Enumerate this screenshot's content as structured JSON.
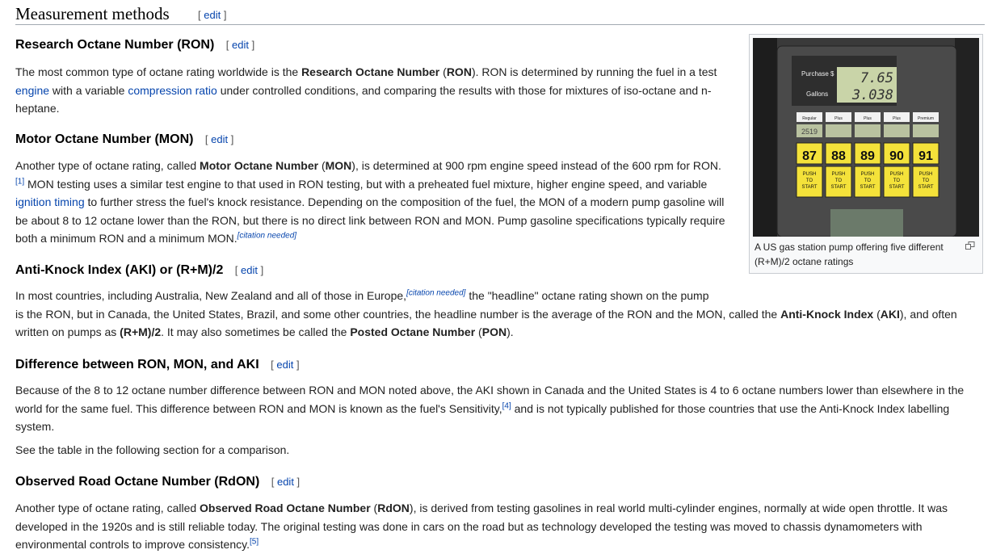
{
  "section": {
    "title": "Measurement methods",
    "edit": "edit"
  },
  "ron": {
    "heading": "Research Octane Number (RON)",
    "edit": "edit",
    "p1": "The most common type of octane rating worldwide is the ",
    "b1": "Research Octane Number",
    "p2": " (",
    "b2": "RON",
    "p3": "). RON is determined by running the fuel in a test",
    "link_engine": "engine",
    "p4": " with a variable ",
    "link_compression": "compression ratio",
    "p5": " under controlled conditions, and comparing the results with those for mixtures of iso-octane and n-heptane."
  },
  "mon": {
    "heading": "Motor Octane Number (MON)",
    "edit": "edit",
    "p1": "Another type of octane rating, called ",
    "b1": "Motor Octane Number",
    "p2": " (",
    "b2": "MON",
    "p3": "), is determined at 900 rpm engine speed instead of the 600 rpm for RON.",
    "ref1": "[1]",
    "p4": " MON testing uses a similar test engine to that used in RON testing, but with a preheated fuel mixture, higher engine speed, and variable ",
    "link_ignition": "ignition timing",
    "p5": " to further stress the fuel's knock resistance. Depending on the composition of the fuel, the MON of a modern pump gasoline will be about 8 to 12 octane lower than the RON, but there is no direct link between RON and MON. Pump gasoline specifications typically require both a minimum RON and a minimum MON.",
    "cn": "[citation needed]"
  },
  "aki": {
    "heading": "Anti-Knock Index (AKI) or (R+M)/2",
    "edit": "edit",
    "p1": "In most countries, including Australia, New Zealand and all of those in Europe,",
    "cn": "[citation needed]",
    "p2": " the \"headline\" octane rating shown on the pump",
    "p3": "is the RON, but in Canada, the United States, Brazil, and some other countries, the headline number is the average of the RON and the MON, called the ",
    "b1": "Anti-Knock Index",
    "p4": " (",
    "b2": "AKI",
    "p5": "), and often written on pumps as ",
    "b3": "(R+M)/2",
    "p6": ". It may also sometimes be called the ",
    "b4": "Posted Octane Number",
    "p7": " (",
    "b5": "PON",
    "p8": ")."
  },
  "diff": {
    "heading": "Difference between RON, MON, and AKI",
    "edit": "edit",
    "p1": "Because of the 8 to 12 octane number difference between RON and MON noted above, the AKI shown in Canada and the United States is 4 to 6 octane numbers lower than elsewhere in the world for the same fuel. This difference between RON and MON is known as the fuel's Sensitivity,",
    "ref4": "[4]",
    "p2": " and is not typically published for those countries that use the Anti-Knock Index labelling system.",
    "see": "See the table in the following section for a comparison."
  },
  "rdon": {
    "heading": "Observed Road Octane Number (RdON)",
    "edit": "edit",
    "p1": "Another type of octane rating, called ",
    "b1": "Observed Road Octane Number",
    "p2": " (",
    "b2": "RdON",
    "p3": "), is derived from testing gasolines in real world multi-cylinder engines, normally at wide open throttle. It was developed in the 1920s and is still reliable today. The original testing was done in cars on the road but as technology developed the testing was moved to chassis dynamometers with environmental controls to improve consistency.",
    "ref5": "[5]"
  },
  "thumb": {
    "caption": "A US gas station pump offering five different (R+M)/2 octane ratings",
    "mag_icon": "enlarge-icon",
    "pump": {
      "purchase_label": "Purchase $",
      "gallons_label": "Gallons",
      "purchase_value": "7.65",
      "gallons_value": "3.038",
      "grades": [
        "Regular",
        "Plus",
        "Plus",
        "Plus",
        "Premium"
      ],
      "octanes": [
        "87",
        "88",
        "89",
        "90",
        "91"
      ],
      "push": "PUSH TO START",
      "price_first": "2519"
    }
  }
}
